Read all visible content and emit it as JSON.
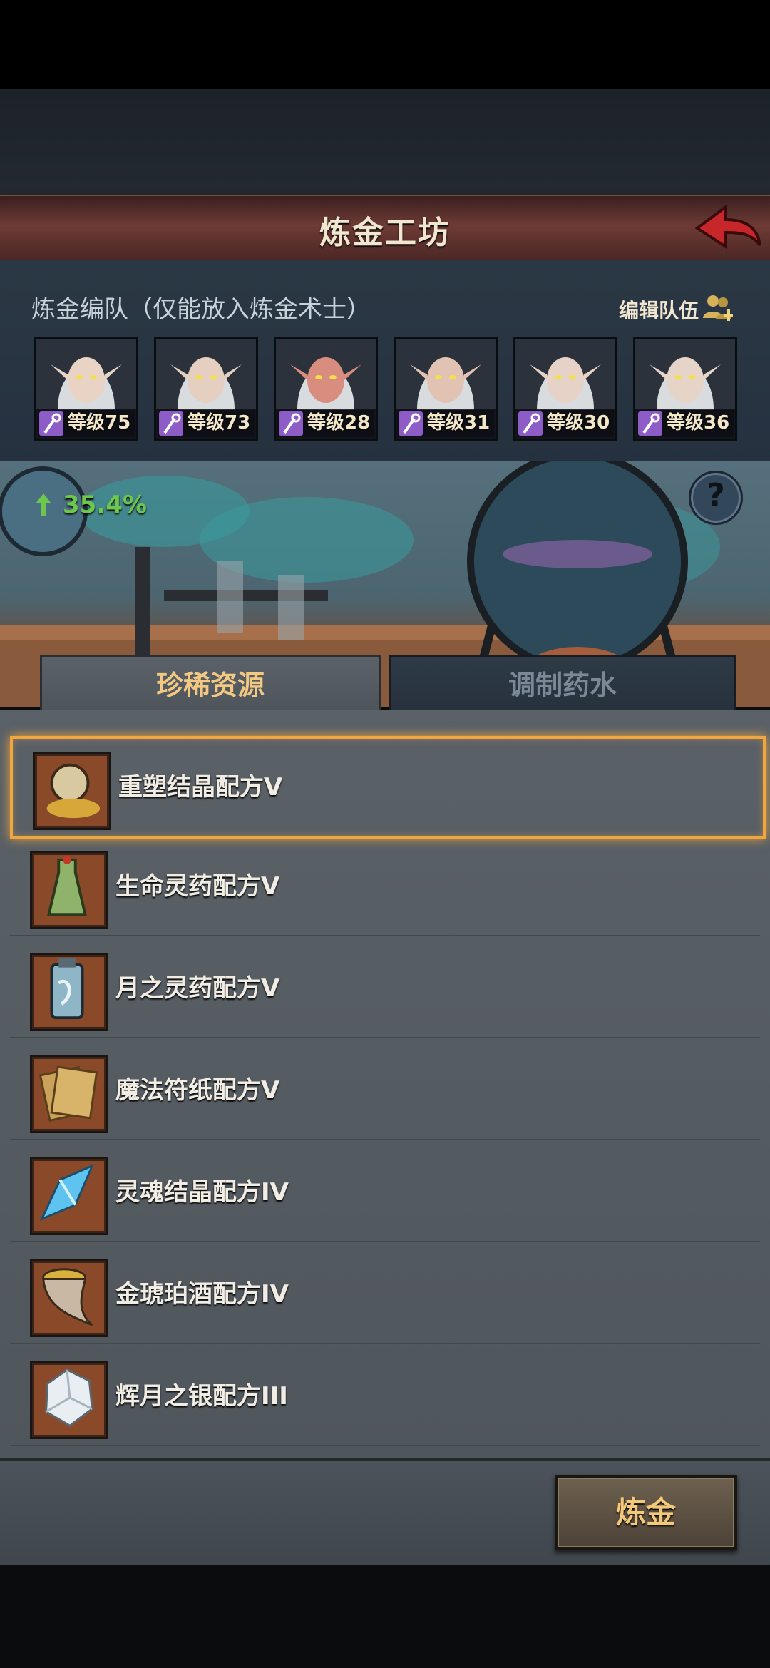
{
  "header": {
    "title": "炼金工坊",
    "back_icon": "red-back-arrow"
  },
  "team": {
    "title": "炼金编队（仅能放入炼金术士）",
    "edit_label": "编辑队伍",
    "heroes": [
      {
        "level": "等级75",
        "skin": "#e8d3c4"
      },
      {
        "level": "等级73",
        "skin": "#e4cfc0"
      },
      {
        "level": "等级28",
        "skin": "#d98d7f"
      },
      {
        "level": "等级31",
        "skin": "#e2c3b3"
      },
      {
        "level": "等级30",
        "skin": "#e6d2c6"
      },
      {
        "level": "等级36",
        "skin": "#e7d4c8"
      }
    ]
  },
  "lab": {
    "bonus": "35.4%",
    "help": "?"
  },
  "tabs": {
    "rare": "珍稀资源",
    "potion": "调制药水",
    "active": "rare"
  },
  "recipes": [
    {
      "name": "重塑结晶配方V",
      "icon": "gold-sand-flask-icon",
      "selected": true
    },
    {
      "name": "生命灵药配方V",
      "icon": "green-potion-icon",
      "selected": false
    },
    {
      "name": "月之灵药配方V",
      "icon": "blue-bottle-icon",
      "selected": false
    },
    {
      "name": "魔法符纸配方V",
      "icon": "parchment-icon",
      "selected": false
    },
    {
      "name": "灵魂结晶配方IV",
      "icon": "blue-crystal-icon",
      "selected": false
    },
    {
      "name": "金琥珀酒配方IV",
      "icon": "horn-cup-icon",
      "selected": false
    },
    {
      "name": "辉月之银配方III",
      "icon": "silver-ore-icon",
      "selected": false
    }
  ],
  "action": {
    "label": "炼金"
  },
  "colors": {
    "accent": "#f1a640",
    "bonus": "#6dc74d",
    "header": "#6e3b35"
  }
}
